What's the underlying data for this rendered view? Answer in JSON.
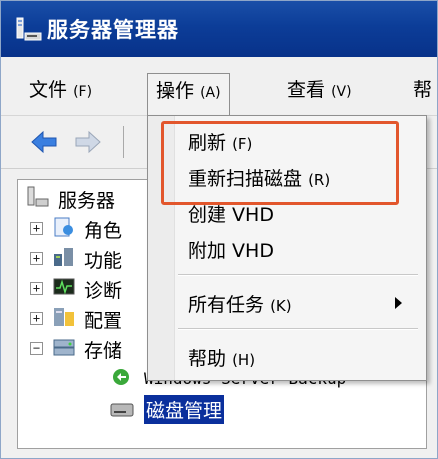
{
  "window": {
    "title": "服务器管理器"
  },
  "menubar": {
    "file": "文件",
    "file_acc": "(F)",
    "action": "操作",
    "action_acc": "(A)",
    "view": "查看",
    "view_acc": "(V)",
    "help": "帮"
  },
  "tree": {
    "root": "服务器",
    "roles": "角色",
    "features": "功能",
    "diagnostics": "诊断",
    "configuration": "配置",
    "storage": "存储",
    "wsb": "Windows Server Backup",
    "disk_mgmt": "磁盘管理"
  },
  "dropdown": {
    "refresh": "刷新",
    "refresh_acc": "(F)",
    "rescan": "重新扫描磁盘",
    "rescan_acc": "(R)",
    "create_vhd": "创建 VHD",
    "attach_vhd": "附加 VHD",
    "all_tasks": "所有任务",
    "all_tasks_acc": "(K)",
    "help": "帮助",
    "help_acc": "(H)"
  },
  "colors": {
    "titlebar": "#0c3d98",
    "highlight": "#e2562c",
    "selection": "#0a2f9c"
  }
}
